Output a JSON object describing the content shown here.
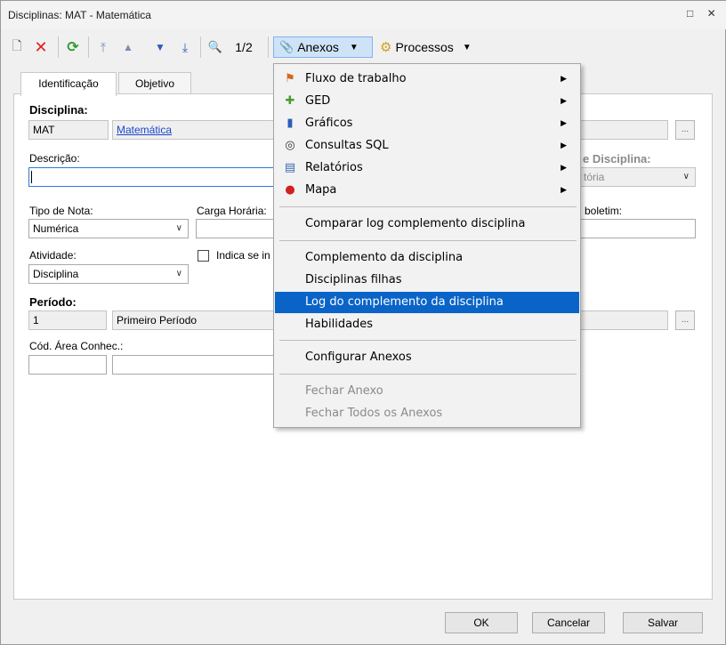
{
  "window": {
    "title": "Disciplinas: MAT - Matemática",
    "controls": "□ ✕"
  },
  "toolbar": {
    "record_position": "1/2",
    "anexos_label": "Anexos",
    "processos_label": "Processos"
  },
  "tabs": [
    {
      "label": "Identificação",
      "active": true
    },
    {
      "label": "Objetivo",
      "active": false
    }
  ],
  "form": {
    "disciplina_label": "Disciplina:",
    "disciplina_code": "MAT",
    "disciplina_name": "Matemática",
    "descricao_label": "Descrição:",
    "descricao_value": "",
    "tipo_disciplina_label": "e Disciplina:",
    "tipo_disciplina_value": "tória",
    "tipo_nota_label": "Tipo de Nota:",
    "tipo_nota_value": "Numérica",
    "carga_horaria_label": "Carga Horária:",
    "boletim_label": "boletim:",
    "atividade_label": "Atividade:",
    "atividade_value": "Disciplina",
    "indica_label": "Indica se in",
    "periodo_label": "Período:",
    "periodo_code": "1",
    "periodo_name": "Primeiro Período",
    "area_label": "Cód. Área Conhec.:",
    "ellipsis": "..."
  },
  "menu": {
    "items": [
      {
        "label": "Fluxo de trabalho",
        "icon": "workflow-icon",
        "submenu": true
      },
      {
        "label": "GED",
        "icon": "ged-icon",
        "submenu": true
      },
      {
        "label": "Gráficos",
        "icon": "chart-icon",
        "submenu": true
      },
      {
        "label": "Consultas SQL",
        "icon": "sql-query-icon",
        "submenu": true
      },
      {
        "label": "Relatórios",
        "icon": "report-icon",
        "submenu": true
      },
      {
        "label": "Mapa",
        "icon": "map-pin-icon",
        "submenu": true
      },
      {
        "label": "Comparar log complemento disciplina"
      },
      {
        "label": "Complemento da disciplina"
      },
      {
        "label": "Disciplinas filhas"
      },
      {
        "label": "Log do complemento da disciplina",
        "highlighted": true
      },
      {
        "label": "Habilidades"
      },
      {
        "label": "Configurar Anexos"
      },
      {
        "label": "Fechar Anexo",
        "disabled": true
      },
      {
        "label": "Fechar Todos os Anexos",
        "disabled": true
      }
    ]
  },
  "buttons": {
    "ok": "OK",
    "cancel": "Cancelar",
    "save": "Salvar"
  },
  "colors": {
    "highlight": "#0a64c8",
    "link": "#1a47c9",
    "focus_border": "#2a7bd3"
  }
}
